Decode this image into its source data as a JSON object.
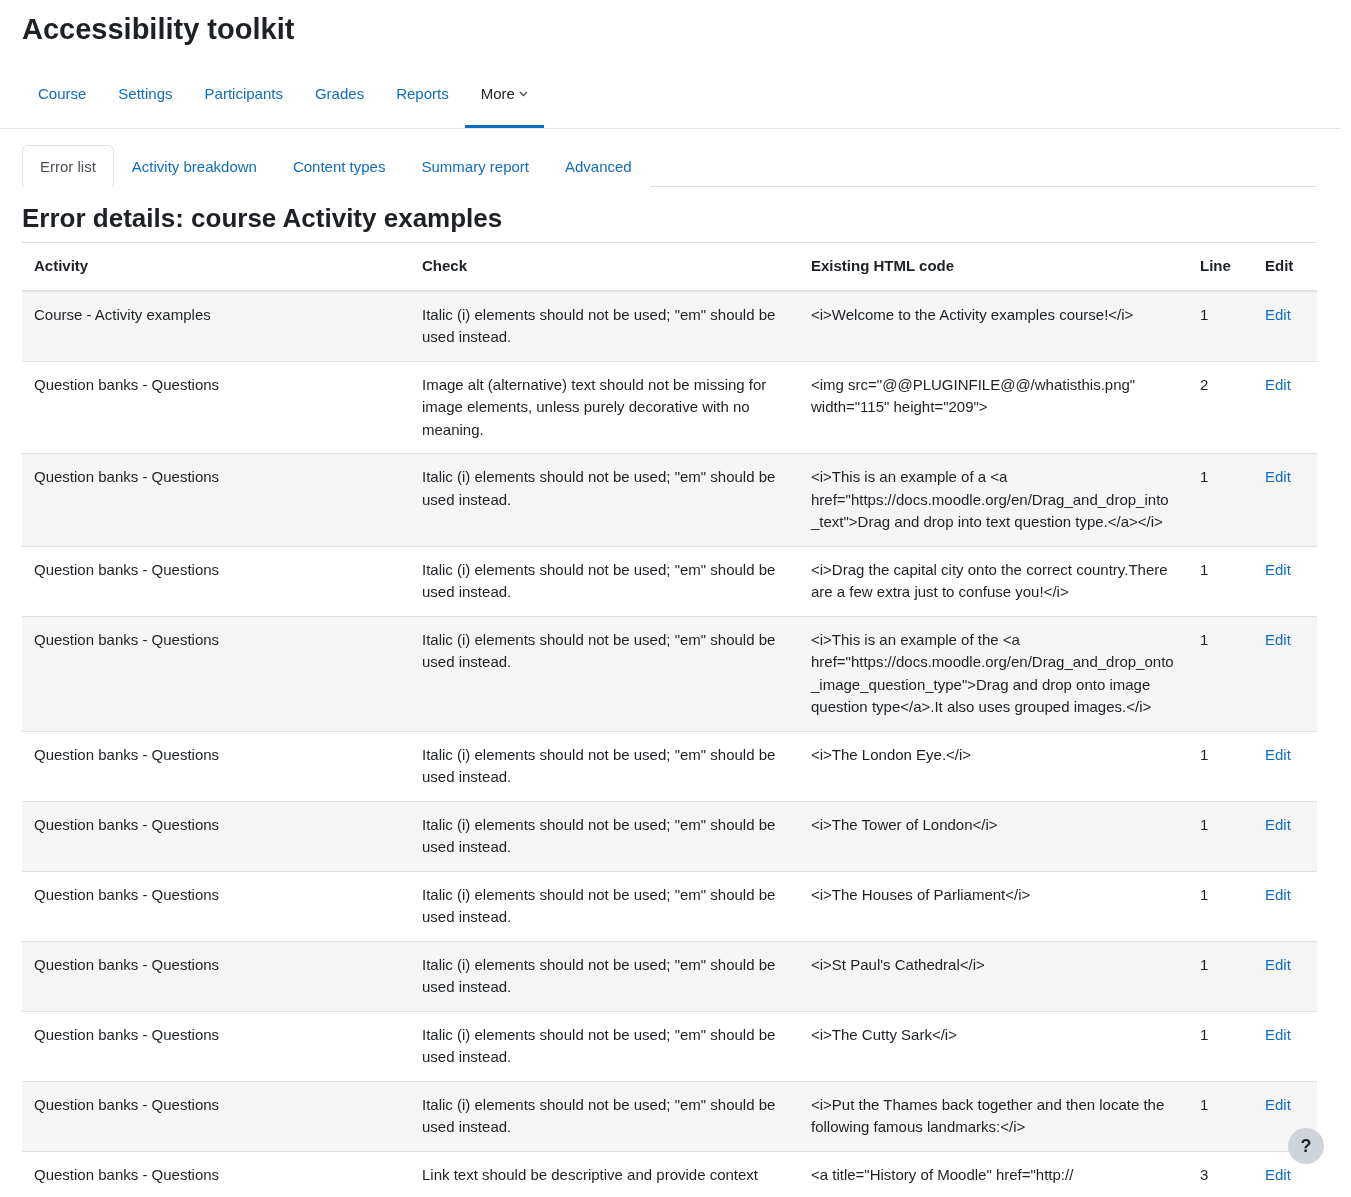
{
  "page_title": "Accessibility toolkit",
  "primary_nav": [
    {
      "label": "Course",
      "selected": false,
      "dropdown": false
    },
    {
      "label": "Settings",
      "selected": false,
      "dropdown": false
    },
    {
      "label": "Participants",
      "selected": false,
      "dropdown": false
    },
    {
      "label": "Grades",
      "selected": false,
      "dropdown": false
    },
    {
      "label": "Reports",
      "selected": false,
      "dropdown": false
    },
    {
      "label": "More",
      "selected": true,
      "dropdown": true
    }
  ],
  "tabs": [
    {
      "label": "Error list",
      "selected": true
    },
    {
      "label": "Activity breakdown",
      "selected": false
    },
    {
      "label": "Content types",
      "selected": false
    },
    {
      "label": "Summary report",
      "selected": false
    },
    {
      "label": "Advanced",
      "selected": false
    }
  ],
  "heading": "Error details: course Activity examples",
  "table": {
    "columns": [
      "Activity",
      "Check",
      "Existing HTML code",
      "Line",
      "Edit"
    ],
    "rows": [
      {
        "activity": "Course - Activity examples",
        "check": "Italic (i) elements should not be used; \"em\" should be used instead.",
        "html": "<i>Welcome to the Activity examples course!</i>",
        "line": "1",
        "edit": "Edit"
      },
      {
        "activity": "Question banks - Questions",
        "check": "Image alt (alternative) text should not be missing for image elements, unless purely decorative with no meaning.",
        "html": "<img src=\"@@PLUGINFILE@@/whatisthis.png\" width=\"115\" height=\"209\">",
        "line": "2",
        "edit": "Edit"
      },
      {
        "activity": "Question banks - Questions",
        "check": "Italic (i) elements should not be used; \"em\" should be used instead.",
        "html": "<i>This is an example of a <a href=\"https://docs.moodle.org/en/Drag_and_drop_into_text\">Drag and drop into text question type.</a></i>",
        "line": "1",
        "edit": "Edit"
      },
      {
        "activity": "Question banks - Questions",
        "check": "Italic (i) elements should not be used; \"em\" should be used instead.",
        "html": "<i>Drag the capital city onto the correct country.There are a few extra just to confuse you!</i>",
        "line": "1",
        "edit": "Edit"
      },
      {
        "activity": "Question banks - Questions",
        "check": "Italic (i) elements should not be used; \"em\" should be used instead.",
        "html": "<i>This is an example of the <a href=\"https://docs.moodle.org/en/Drag_and_drop_onto_image_question_type\">Drag and drop onto image question type</a>.It also uses grouped images.</i>",
        "line": "1",
        "edit": "Edit"
      },
      {
        "activity": "Question banks - Questions",
        "check": "Italic (i) elements should not be used; \"em\" should be used instead.",
        "html": "<i>The London Eye.</i>",
        "line": "1",
        "edit": "Edit"
      },
      {
        "activity": "Question banks - Questions",
        "check": "Italic (i) elements should not be used; \"em\" should be used instead.",
        "html": "<i>The Tower of London</i>",
        "line": "1",
        "edit": "Edit"
      },
      {
        "activity": "Question banks - Questions",
        "check": "Italic (i) elements should not be used; \"em\" should be used instead.",
        "html": "<i>The Houses of Parliament</i>",
        "line": "1",
        "edit": "Edit"
      },
      {
        "activity": "Question banks - Questions",
        "check": "Italic (i) elements should not be used; \"em\" should be used instead.",
        "html": "<i>St Paul's Cathedral</i>",
        "line": "1",
        "edit": "Edit"
      },
      {
        "activity": "Question banks - Questions",
        "check": "Italic (i) elements should not be used; \"em\" should be used instead.",
        "html": "<i>The Cutty Sark</i>",
        "line": "1",
        "edit": "Edit"
      },
      {
        "activity": "Question banks - Questions",
        "check": "Italic (i) elements should not be used; \"em\" should be used instead.",
        "html": "<i>Put the Thames back together and then locate the following famous landmarks:</i>",
        "line": "1",
        "edit": "Edit"
      },
      {
        "activity": "Question banks - Questions",
        "check": "Link text should be descriptive and provide context",
        "html": "<a title=\"History of Moodle\" href=\"http://",
        "line": "3",
        "edit": "Edit"
      }
    ]
  },
  "help_button": "?"
}
